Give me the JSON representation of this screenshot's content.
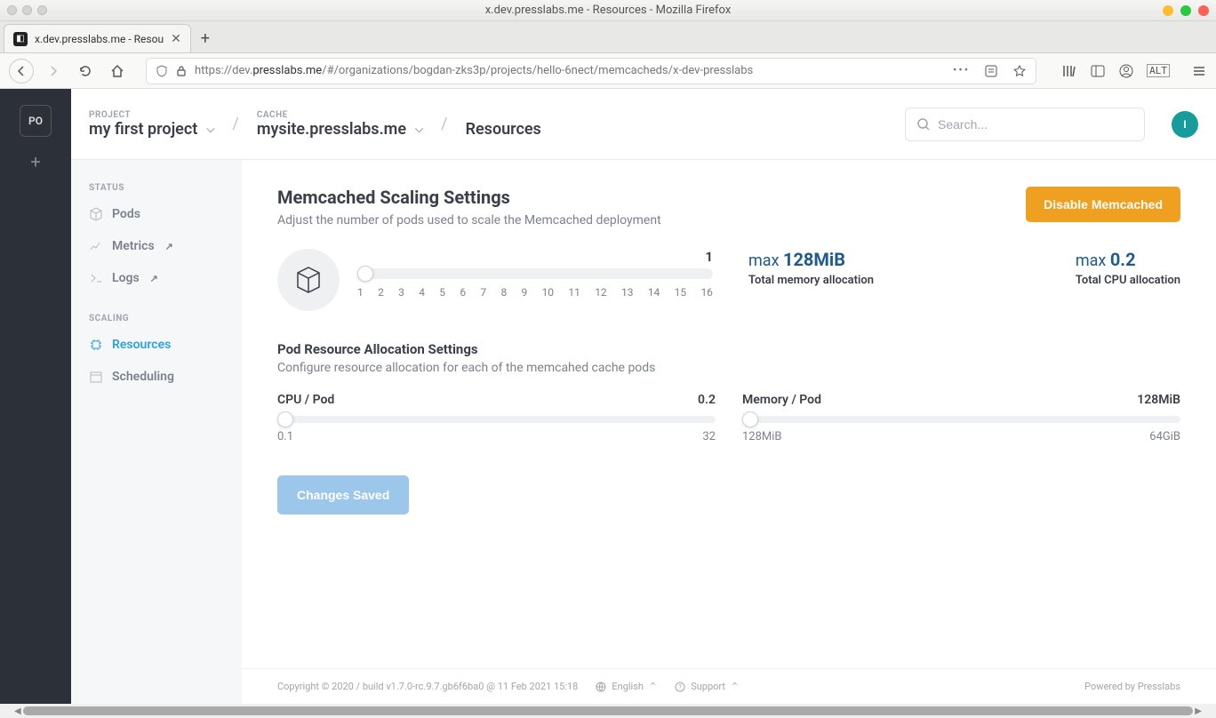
{
  "window": {
    "title": "x.dev.presslabs.me - Resources - Mozilla Firefox"
  },
  "tab": {
    "title": "x.dev.presslabs.me - Resou"
  },
  "url": {
    "prefix": "https://dev.",
    "domain": "presslabs.me",
    "path": "/#/organizations/bogdan-zks3p/projects/hello-6nect/memcacheds/x-dev-presslabs"
  },
  "org_badge": "PO",
  "breadcrumb": {
    "project_label": "PROJECT",
    "project_value": "my first project",
    "cache_label": "CACHE",
    "cache_value": "mysite.presslabs.me",
    "page": "Resources"
  },
  "search": {
    "placeholder": "Search..."
  },
  "avatar": "I",
  "sidebar": {
    "status_label": "STATUS",
    "scaling_label": "SCALING",
    "items": {
      "pods": "Pods",
      "metrics": "Metrics",
      "logs": "Logs",
      "resources": "Resources",
      "scheduling": "Scheduling"
    }
  },
  "main": {
    "title": "Memcached Scaling Settings",
    "subtitle": "Adjust the number of pods used to scale the Memcached deployment",
    "disable_btn": "Disable Memcached",
    "pod_count_value": "1",
    "ticks": [
      "1",
      "2",
      "3",
      "4",
      "5",
      "6",
      "7",
      "8",
      "9",
      "10",
      "11",
      "12",
      "13",
      "14",
      "15",
      "16"
    ],
    "mem_alloc": {
      "prefix": "max ",
      "value": "128MiB",
      "label": "Total memory allocation"
    },
    "cpu_alloc": {
      "prefix": "max ",
      "value": "0.2",
      "label": "Total CPU allocation"
    },
    "sub_title": "Pod Resource Allocation Settings",
    "sub_sub": "Configure resource allocation for each of the memcahed cache pods",
    "cpu_per_pod": {
      "label": "CPU / Pod",
      "value": "0.2",
      "min": "0.1",
      "max": "32"
    },
    "mem_per_pod": {
      "label": "Memory / Pod",
      "value": "128MiB",
      "min": "128MiB",
      "max": "64GiB"
    },
    "save_btn": "Changes Saved"
  },
  "footer": {
    "copy": "Copyright © 2020 / build v1.7.0-rc.9.7.gb6f6ba0 @ 11 Feb 2021 15:18",
    "lang": "English",
    "support": "Support",
    "powered": "Powered by Presslabs"
  }
}
